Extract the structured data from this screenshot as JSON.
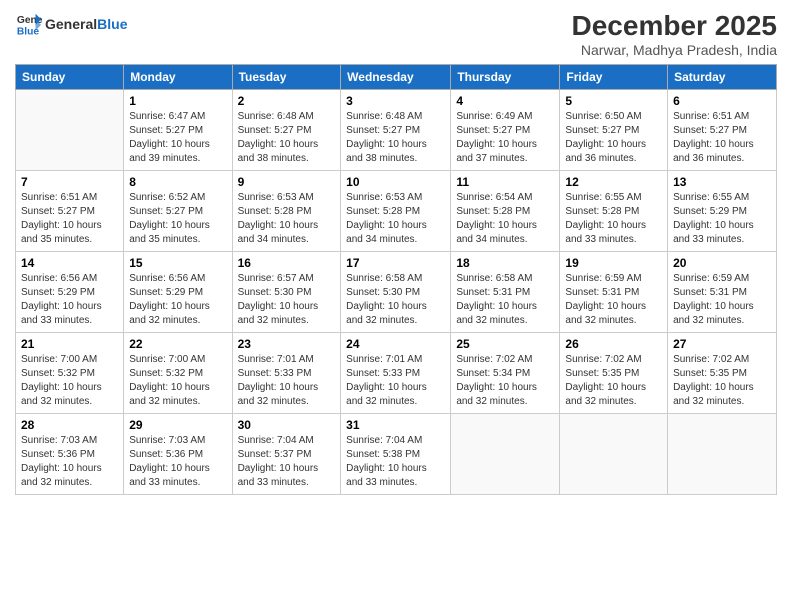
{
  "header": {
    "logo_general": "General",
    "logo_blue": "Blue",
    "month_title": "December 2025",
    "subtitle": "Narwar, Madhya Pradesh, India"
  },
  "days_of_week": [
    "Sunday",
    "Monday",
    "Tuesday",
    "Wednesday",
    "Thursday",
    "Friday",
    "Saturday"
  ],
  "weeks": [
    [
      {
        "day": "",
        "info": ""
      },
      {
        "day": "1",
        "info": "Sunrise: 6:47 AM\nSunset: 5:27 PM\nDaylight: 10 hours\nand 39 minutes."
      },
      {
        "day": "2",
        "info": "Sunrise: 6:48 AM\nSunset: 5:27 PM\nDaylight: 10 hours\nand 38 minutes."
      },
      {
        "day": "3",
        "info": "Sunrise: 6:48 AM\nSunset: 5:27 PM\nDaylight: 10 hours\nand 38 minutes."
      },
      {
        "day": "4",
        "info": "Sunrise: 6:49 AM\nSunset: 5:27 PM\nDaylight: 10 hours\nand 37 minutes."
      },
      {
        "day": "5",
        "info": "Sunrise: 6:50 AM\nSunset: 5:27 PM\nDaylight: 10 hours\nand 36 minutes."
      },
      {
        "day": "6",
        "info": "Sunrise: 6:51 AM\nSunset: 5:27 PM\nDaylight: 10 hours\nand 36 minutes."
      }
    ],
    [
      {
        "day": "7",
        "info": "Sunrise: 6:51 AM\nSunset: 5:27 PM\nDaylight: 10 hours\nand 35 minutes."
      },
      {
        "day": "8",
        "info": "Sunrise: 6:52 AM\nSunset: 5:27 PM\nDaylight: 10 hours\nand 35 minutes."
      },
      {
        "day": "9",
        "info": "Sunrise: 6:53 AM\nSunset: 5:28 PM\nDaylight: 10 hours\nand 34 minutes."
      },
      {
        "day": "10",
        "info": "Sunrise: 6:53 AM\nSunset: 5:28 PM\nDaylight: 10 hours\nand 34 minutes."
      },
      {
        "day": "11",
        "info": "Sunrise: 6:54 AM\nSunset: 5:28 PM\nDaylight: 10 hours\nand 34 minutes."
      },
      {
        "day": "12",
        "info": "Sunrise: 6:55 AM\nSunset: 5:28 PM\nDaylight: 10 hours\nand 33 minutes."
      },
      {
        "day": "13",
        "info": "Sunrise: 6:55 AM\nSunset: 5:29 PM\nDaylight: 10 hours\nand 33 minutes."
      }
    ],
    [
      {
        "day": "14",
        "info": "Sunrise: 6:56 AM\nSunset: 5:29 PM\nDaylight: 10 hours\nand 33 minutes."
      },
      {
        "day": "15",
        "info": "Sunrise: 6:56 AM\nSunset: 5:29 PM\nDaylight: 10 hours\nand 32 minutes."
      },
      {
        "day": "16",
        "info": "Sunrise: 6:57 AM\nSunset: 5:30 PM\nDaylight: 10 hours\nand 32 minutes."
      },
      {
        "day": "17",
        "info": "Sunrise: 6:58 AM\nSunset: 5:30 PM\nDaylight: 10 hours\nand 32 minutes."
      },
      {
        "day": "18",
        "info": "Sunrise: 6:58 AM\nSunset: 5:31 PM\nDaylight: 10 hours\nand 32 minutes."
      },
      {
        "day": "19",
        "info": "Sunrise: 6:59 AM\nSunset: 5:31 PM\nDaylight: 10 hours\nand 32 minutes."
      },
      {
        "day": "20",
        "info": "Sunrise: 6:59 AM\nSunset: 5:31 PM\nDaylight: 10 hours\nand 32 minutes."
      }
    ],
    [
      {
        "day": "21",
        "info": "Sunrise: 7:00 AM\nSunset: 5:32 PM\nDaylight: 10 hours\nand 32 minutes."
      },
      {
        "day": "22",
        "info": "Sunrise: 7:00 AM\nSunset: 5:32 PM\nDaylight: 10 hours\nand 32 minutes."
      },
      {
        "day": "23",
        "info": "Sunrise: 7:01 AM\nSunset: 5:33 PM\nDaylight: 10 hours\nand 32 minutes."
      },
      {
        "day": "24",
        "info": "Sunrise: 7:01 AM\nSunset: 5:33 PM\nDaylight: 10 hours\nand 32 minutes."
      },
      {
        "day": "25",
        "info": "Sunrise: 7:02 AM\nSunset: 5:34 PM\nDaylight: 10 hours\nand 32 minutes."
      },
      {
        "day": "26",
        "info": "Sunrise: 7:02 AM\nSunset: 5:35 PM\nDaylight: 10 hours\nand 32 minutes."
      },
      {
        "day": "27",
        "info": "Sunrise: 7:02 AM\nSunset: 5:35 PM\nDaylight: 10 hours\nand 32 minutes."
      }
    ],
    [
      {
        "day": "28",
        "info": "Sunrise: 7:03 AM\nSunset: 5:36 PM\nDaylight: 10 hours\nand 32 minutes."
      },
      {
        "day": "29",
        "info": "Sunrise: 7:03 AM\nSunset: 5:36 PM\nDaylight: 10 hours\nand 33 minutes."
      },
      {
        "day": "30",
        "info": "Sunrise: 7:04 AM\nSunset: 5:37 PM\nDaylight: 10 hours\nand 33 minutes."
      },
      {
        "day": "31",
        "info": "Sunrise: 7:04 AM\nSunset: 5:38 PM\nDaylight: 10 hours\nand 33 minutes."
      },
      {
        "day": "",
        "info": ""
      },
      {
        "day": "",
        "info": ""
      },
      {
        "day": "",
        "info": ""
      }
    ]
  ]
}
